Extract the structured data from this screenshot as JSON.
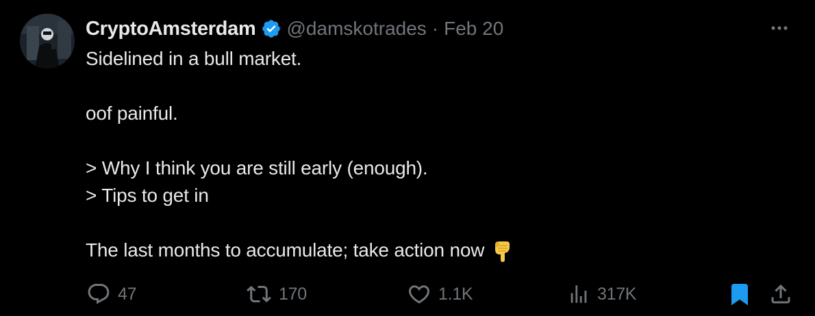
{
  "tweet": {
    "author": {
      "display_name": "CryptoAmsterdam",
      "handle": "@damskotrades",
      "verified": true,
      "avatar_icon": "avatar-photo"
    },
    "separator": "·",
    "date": "Feb 20",
    "text_lines": [
      "Sidelined in a bull market.",
      "",
      "oof painful.",
      "",
      "> Why I think you are still early (enough).",
      "> Tips to get in",
      "",
      "The last months to accumulate; take action now"
    ],
    "trailing_emoji": "backhand-index-pointing-down",
    "actions": {
      "replies": "47",
      "retweets": "170",
      "likes": "1.1K",
      "views": "317K"
    },
    "bookmarked": true
  },
  "colors": {
    "background": "#000000",
    "text": "#e7e9ea",
    "secondary": "#71767b",
    "verified": "#1d9bf0",
    "bookmark": "#1d9bf0"
  }
}
